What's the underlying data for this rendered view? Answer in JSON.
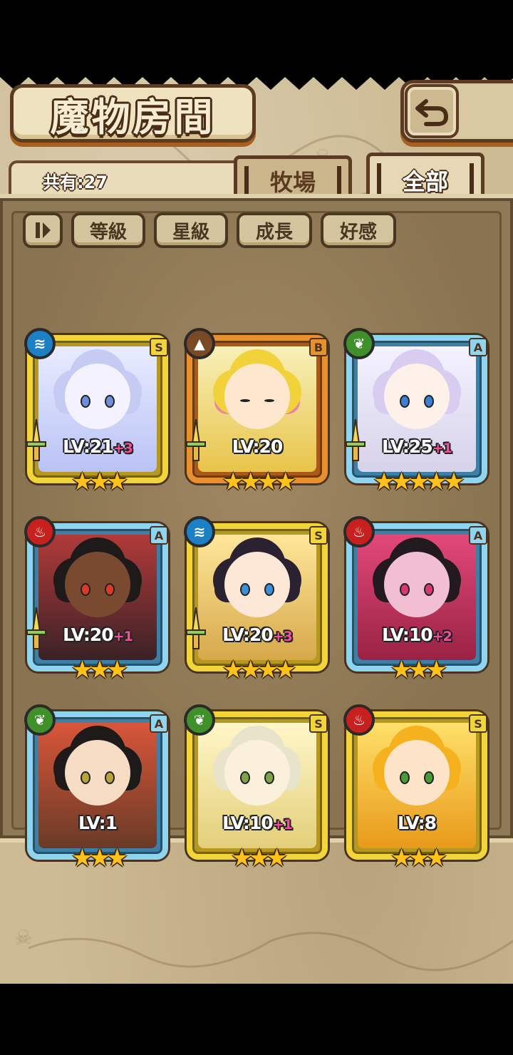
{
  "header": {
    "title": "魔物房間",
    "back_icon": "back-arrow-icon"
  },
  "tabs": {
    "count_label": "共有:27",
    "ranch_label": "牧場",
    "all_label": "全部"
  },
  "sort_buttons": {
    "toggle_icon": "pause-sort-icon",
    "level": "等級",
    "star": "星級",
    "growth": "成長",
    "affection": "好感"
  },
  "cards": [
    {
      "lv": "LV:21",
      "plus": "+3",
      "rank": "S",
      "stars": "★★★",
      "element": "water",
      "frame": "gold",
      "weapon": true
    },
    {
      "lv": "LV:20",
      "plus": "",
      "rank": "B",
      "stars": "★★★★",
      "element": "earth",
      "frame": "bronze",
      "weapon": true
    },
    {
      "lv": "LV:25",
      "plus": "+1",
      "rank": "A",
      "stars": "★★★★★",
      "element": "wood",
      "frame": "blue",
      "weapon": true
    },
    {
      "lv": "LV:20",
      "plus": "+1",
      "rank": "A",
      "stars": "★★★",
      "element": "fire",
      "frame": "blue",
      "weapon": true
    },
    {
      "lv": "LV:20",
      "plus": "+3",
      "rank": "S",
      "stars": "★★★★",
      "element": "water",
      "frame": "gold",
      "weapon": true
    },
    {
      "lv": "LV:10",
      "plus": "+2",
      "rank": "A",
      "stars": "★★★",
      "element": "fire",
      "frame": "blue",
      "weapon": false
    },
    {
      "lv": "LV:1",
      "plus": "",
      "rank": "A",
      "stars": "★★★",
      "element": "wood",
      "frame": "blue",
      "weapon": false
    },
    {
      "lv": "LV:10",
      "plus": "+1",
      "rank": "S",
      "stars": "★★★",
      "element": "wood",
      "frame": "gold",
      "weapon": false
    },
    {
      "lv": "LV:8",
      "plus": "",
      "rank": "S",
      "stars": "★★★",
      "element": "fire",
      "frame": "gold",
      "weapon": false
    }
  ],
  "colors": {
    "water": "#1d7fc4",
    "earth": "#7a4a26",
    "wood": "#3f8f2a",
    "fire": "#c8201e"
  }
}
